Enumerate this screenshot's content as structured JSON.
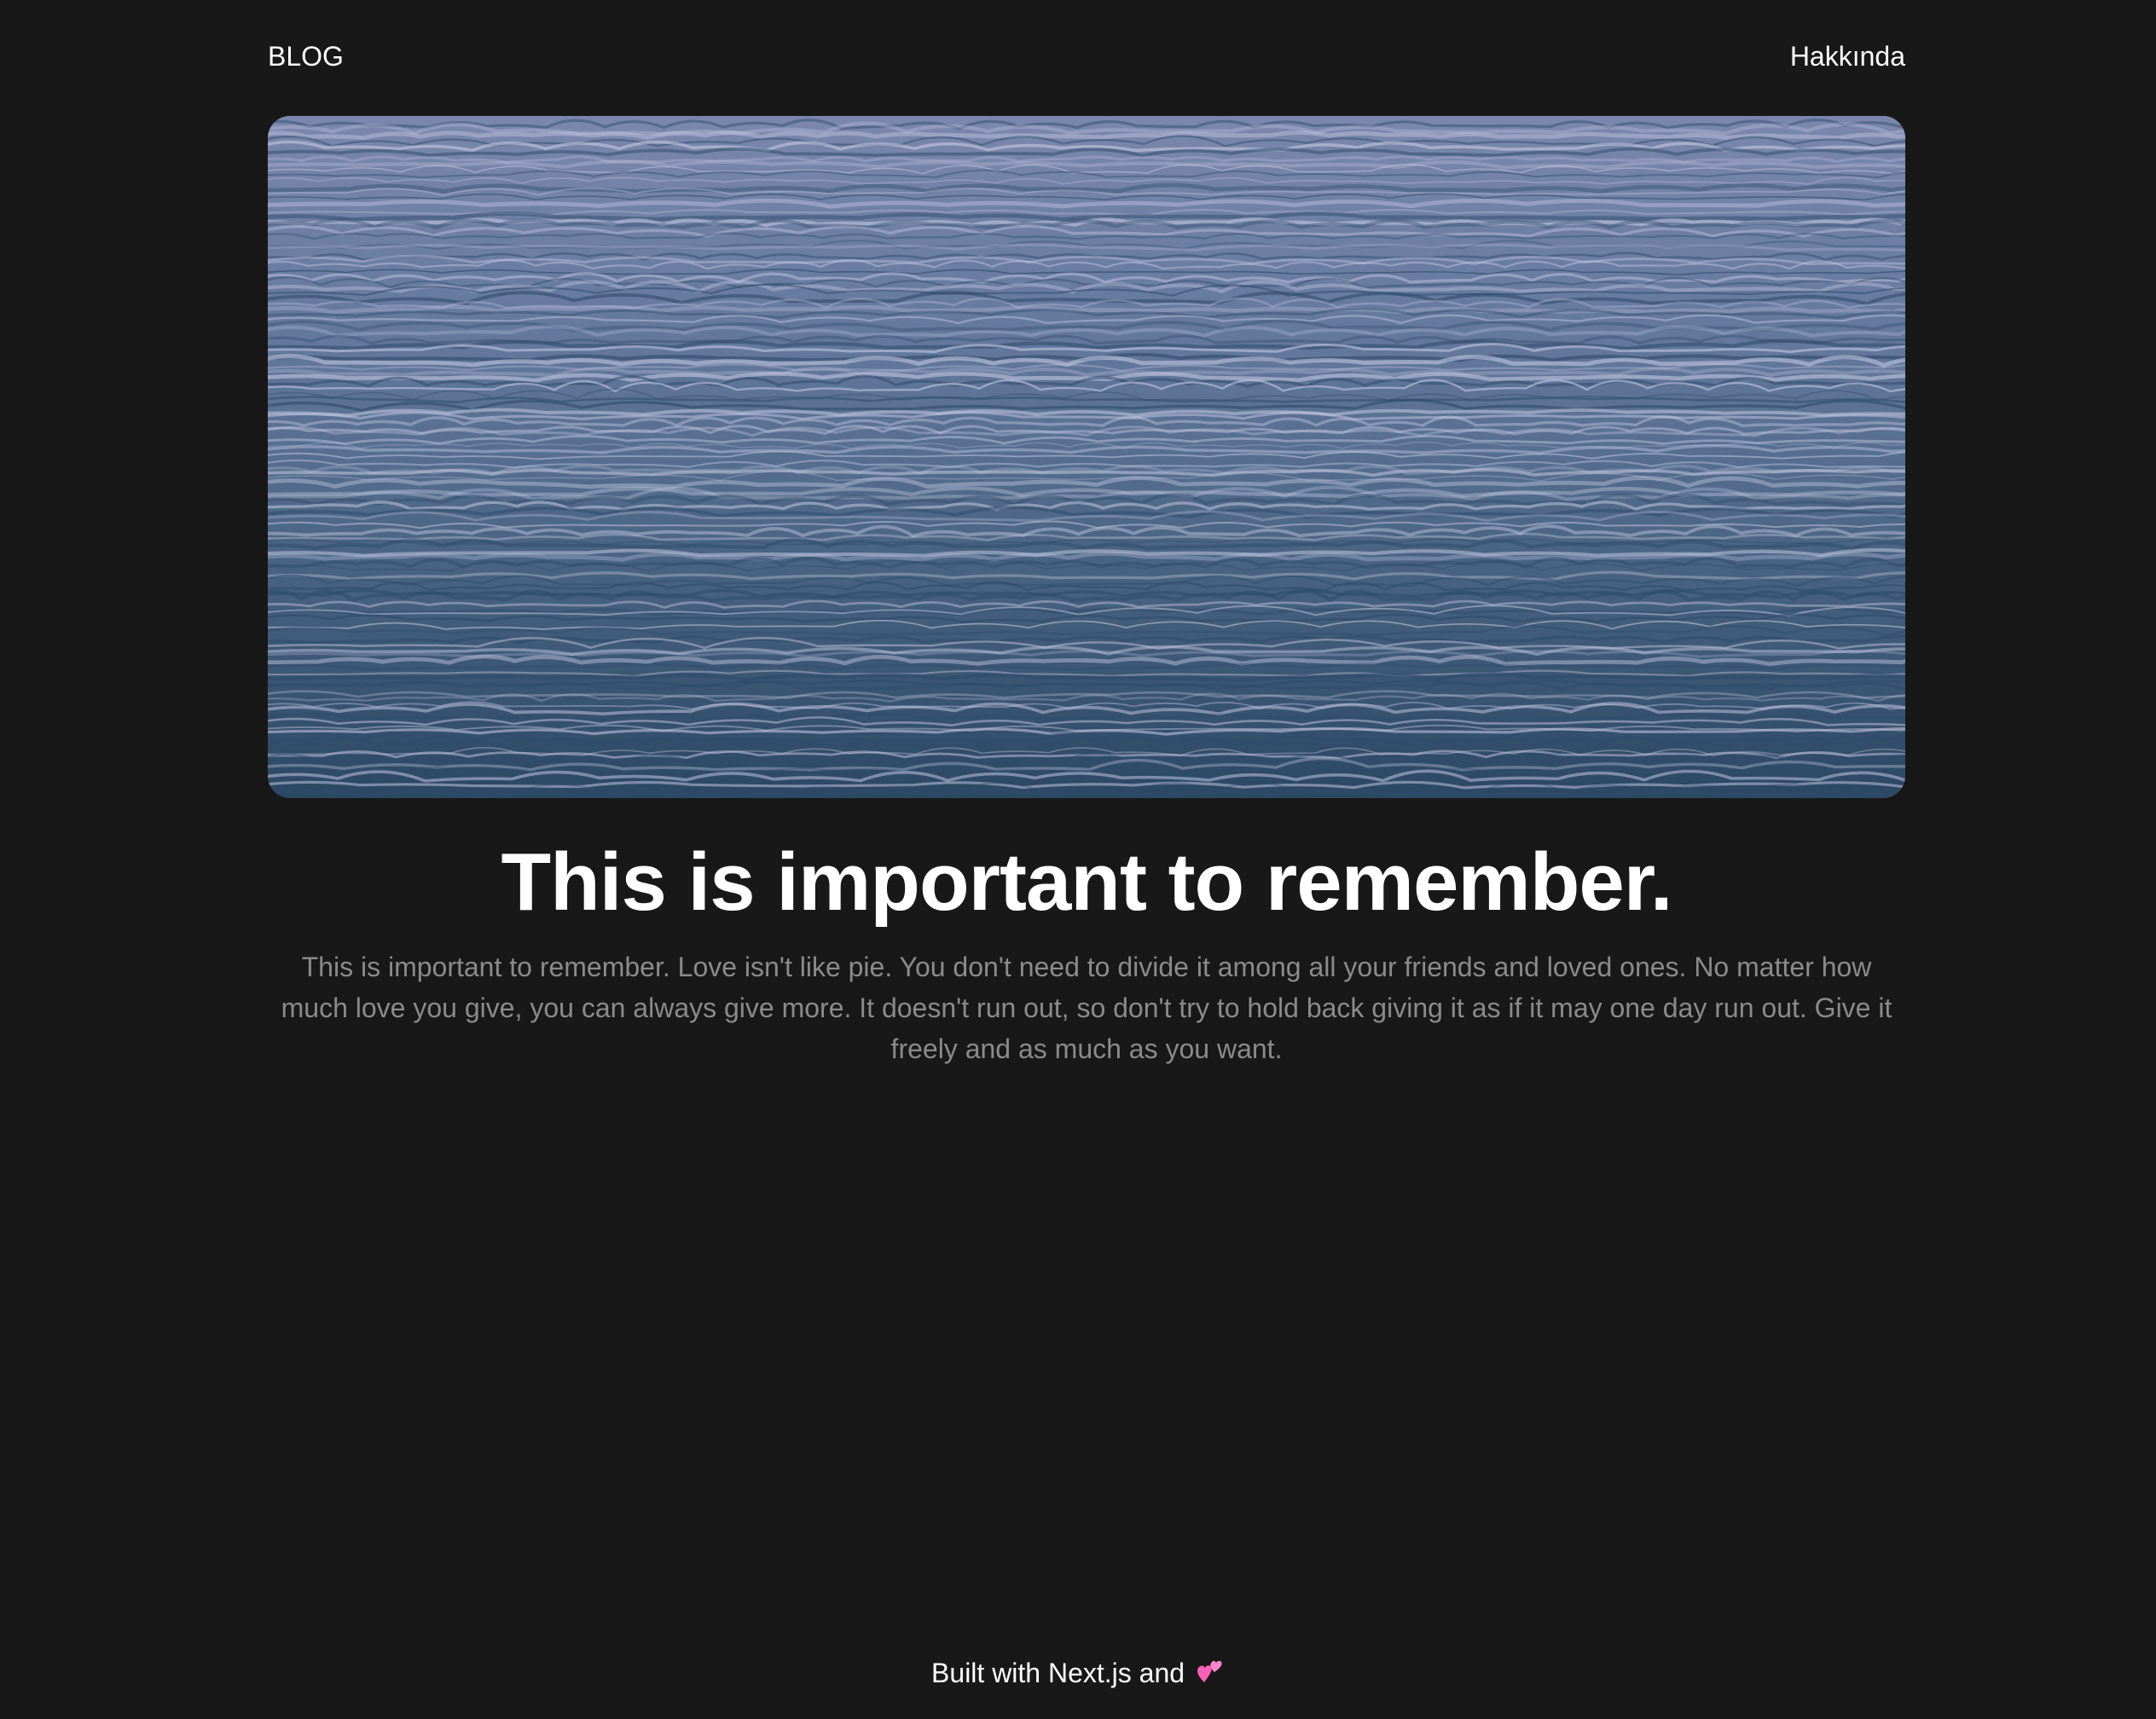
{
  "nav": {
    "home_label": "BLOG",
    "about_label": "Hakkında"
  },
  "post": {
    "title": "This is important to remember.",
    "excerpt": "This is important to remember. Love isn't like pie. You don't need to divide it among all your friends and loved ones. No matter how much love you give, you can always give more. It doesn't run out, so don't try to hold back giving it as if it may one day run out. Give it freely and as much as you want."
  },
  "footer": {
    "text": "Built with Next.js and",
    "icon": "two-hearts-icon"
  },
  "colors": {
    "background": "#181818",
    "text": "#ffffff",
    "muted": "#8b8b8b",
    "heart": "#ff5fb8"
  }
}
